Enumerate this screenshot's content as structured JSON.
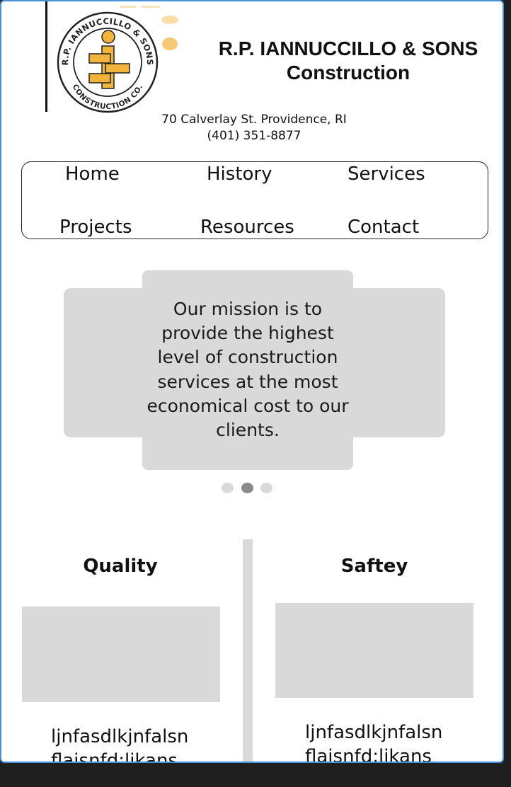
{
  "header": {
    "logo": {
      "ring_top_text": "R.P. IANNUCCILLO & SONS",
      "ring_bottom_text": "CONSTRUCTION CO."
    },
    "title_line1": "R.P. IANNUCCILLO & SONS",
    "title_line2": "Construction",
    "address": "70 Calverlay St. Providence, RI",
    "phone": "(401) 351-8877"
  },
  "nav": {
    "items": [
      {
        "label": "Home"
      },
      {
        "label": "History"
      },
      {
        "label": "Services"
      },
      {
        "label": "Projects"
      },
      {
        "label": "Resources"
      },
      {
        "label": "Contact"
      }
    ]
  },
  "carousel": {
    "mission": "Our mission is to provide the highest level of construction services at the most economical cost to our clients.",
    "active_index": 1,
    "slide_count": 3
  },
  "features": {
    "left": {
      "title": "Quality",
      "text": "ljnfasdlkjnfalsn flaisnfd;likans"
    },
    "right": {
      "title": "Saftey",
      "text": "ljnfasdlkjnfalsn flaisnfd;likans"
    }
  },
  "colors": {
    "frame_border": "#4a8fd9",
    "logo_gold": "#f2b43a",
    "placeholder_gray": "#d9d9d9",
    "dot_active": "#8a8a8a",
    "dot_inactive": "#d9d9d9"
  }
}
